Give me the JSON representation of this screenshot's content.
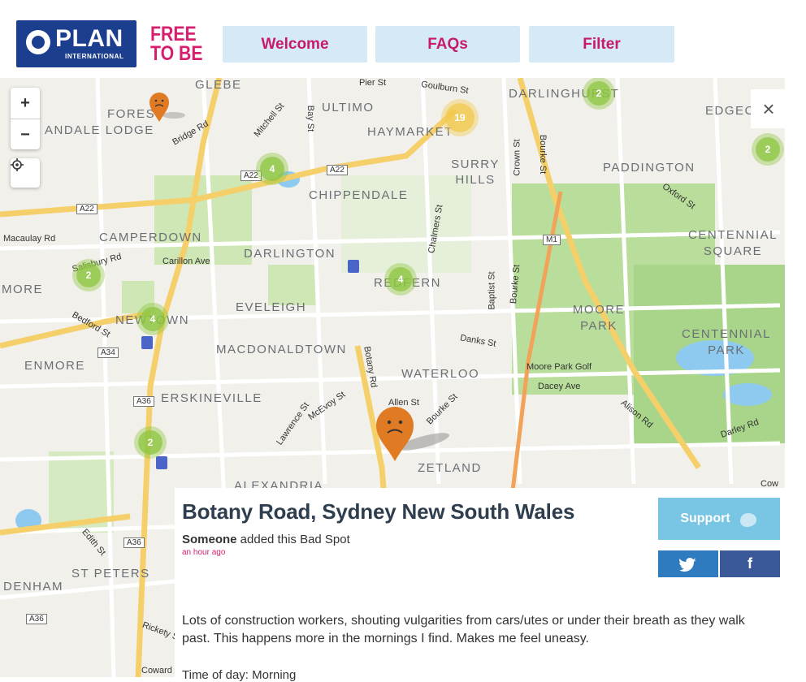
{
  "header": {
    "logo_plan": "PLAN",
    "logo_intl": "INTERNATIONAL",
    "logo_free_line1": "FREE",
    "logo_free_line2": "TO BE",
    "nav": [
      "Welcome",
      "FAQs",
      "Filter"
    ]
  },
  "map": {
    "zoom_in": "+",
    "zoom_out": "−",
    "close": "×",
    "suburbs": [
      "GLEBE",
      "FOREST",
      "ANDALE LODGE",
      "ULTIMO",
      "HAYMARKET",
      "DARLINGHURST",
      "EDGECLIFF",
      "SURRY HILLS",
      "PADDINGTON",
      "CHIPPENDALE",
      "CAMPERDOWN",
      "DARLINGTON",
      "CENTENNIAL SQUARE",
      "MORE",
      "REDFERN",
      "EVELEIGH",
      "NEWTOWN",
      "MOORE PARK",
      "CENTENNIAL PARK",
      "ENMORE",
      "MACDONALDTOWN",
      "WATERLOO",
      "ERSKINEVILLE",
      "ZETLAND",
      "ALEXANDRIA",
      "ST PETERS",
      "DENHAM"
    ],
    "streets": [
      "Pier St",
      "Goulburn St",
      "Bridge Rd",
      "Mitchell St",
      "Bay St",
      "Crown St",
      "Bourke St",
      "Oxford St",
      "Macaulay Rd",
      "Salisbury Rd",
      "Carillon Ave",
      "Chalmers St",
      "Baptist St",
      "Bourke St",
      "Bedford St",
      "Danks St",
      "Botany Rd",
      "Moore Park Golf",
      "Dacey Ave",
      "Alison Rd",
      "Darley Rd",
      "McEvoy St",
      "Allen St",
      "Bourke St",
      "Lawrence St",
      "Edith St",
      "Rickety St",
      "Coward St",
      "Cow"
    ],
    "roads": [
      "A22",
      "A22",
      "A22",
      "M1",
      "A34",
      "A36",
      "A36",
      "A36"
    ],
    "clusters": [
      "19",
      "2",
      "2",
      "4",
      "2",
      "4",
      "4",
      "2"
    ]
  },
  "panel": {
    "title": "Botany Road, Sydney New South Wales",
    "user": "Someone",
    "action": " added this Bad Spot",
    "time_ago": "an hour ago",
    "description": "Lots of construction workers, shouting vulgarities from cars/utes or under their breath as they walk past. This happens more in the mornings I find. Makes me feel uneasy.",
    "time_of_day": "Time of day: Morning",
    "support_label": "Support",
    "twitter_icon": "twitter-icon",
    "facebook_label": "f"
  },
  "colors": {
    "brand_blue": "#1b3e8e",
    "brand_pink": "#d6206f",
    "nav_bg": "#d5eaf5",
    "cluster_green": "#8dc63f",
    "cluster_yellow": "#f2c94c",
    "marker_orange": "#e07b24",
    "support_blue": "#79c6e4",
    "twitter_blue": "#2f7bbf",
    "facebook_blue": "#3b5998"
  }
}
